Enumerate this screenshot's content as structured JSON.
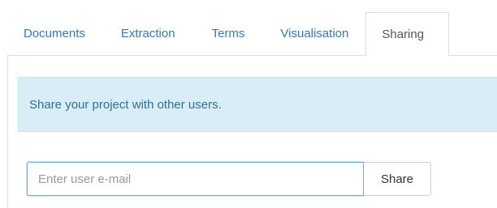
{
  "tabs": [
    {
      "label": "Documents",
      "active": false
    },
    {
      "label": "Extraction",
      "active": false
    },
    {
      "label": "Terms",
      "active": false
    },
    {
      "label": "Visualisation",
      "active": false
    },
    {
      "label": "Sharing",
      "active": true
    }
  ],
  "alert": {
    "text": "Share your project with other users."
  },
  "share_form": {
    "email_placeholder": "Enter user e-mail",
    "email_value": "",
    "share_label": "Share"
  },
  "colors": {
    "link": "#337ab7",
    "active_tab_text": "#555555",
    "alert_bg": "#d9edf7",
    "alert_text": "#31708f",
    "input_focus_border": "#66afe9"
  }
}
